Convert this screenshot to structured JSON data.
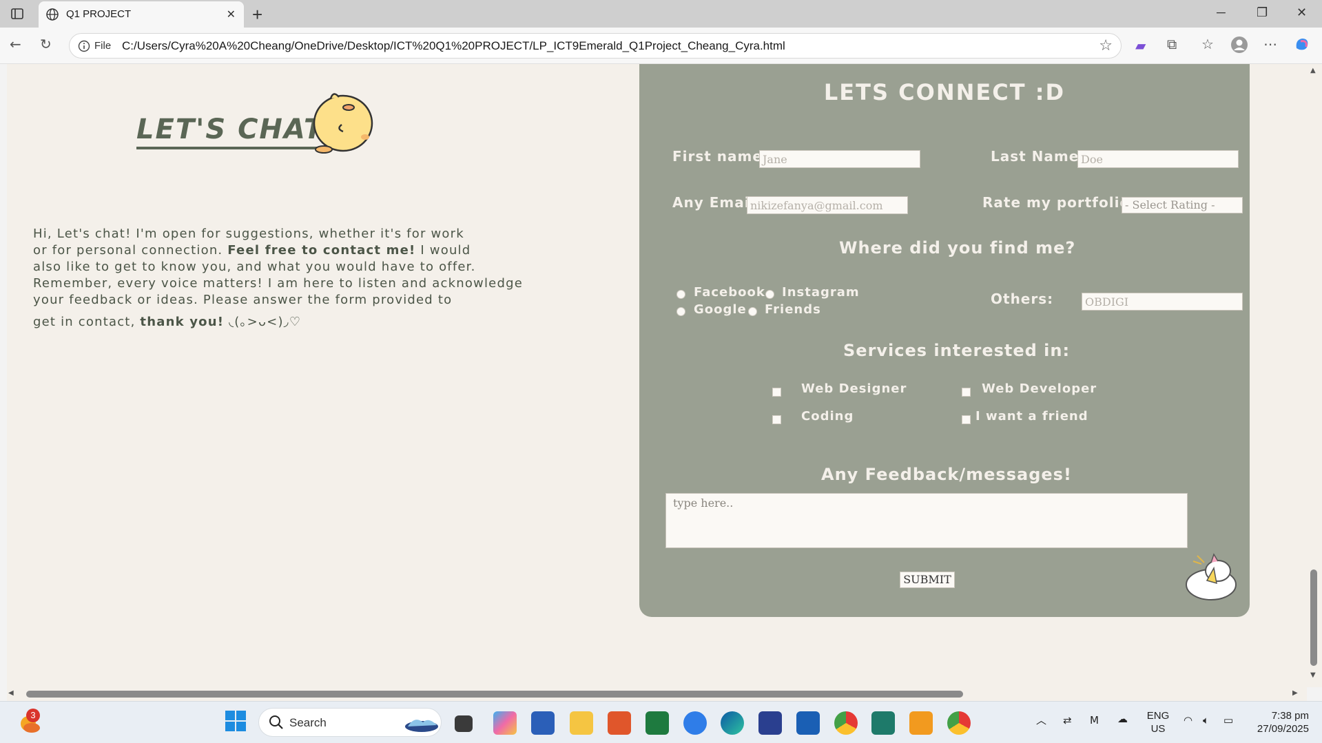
{
  "browser": {
    "tab_title": "Q1 PROJECT",
    "address_prefix": "File",
    "url": "C:/Users/Cyra%20A%20Cheang/OneDrive/Desktop/ICT%20Q1%20PROJECT/LP_ICT9Emerald_Q1Project_Cheang_Cyra.html"
  },
  "left": {
    "title": "LET'S CHAT",
    "intro_line1": "Hi, Let's chat! I'm open for suggestions, whether it's for work",
    "intro_line2a": "or for personal connection. ",
    "intro_line2b": "Feel free to contact me!",
    "intro_line2c": " I would",
    "intro_line3": "also like to get to know you, and what you would have to offer.",
    "intro_line4": "Remember, every voice matters! I am here to listen and acknowledge",
    "intro_line5": "your feedback or ideas. Please answer the form provided to",
    "intro_line6a": "get in contact, ",
    "intro_line6b": "thank you!",
    "intro_line6c": " ◟(｡>ᴗ<)◞♡"
  },
  "form": {
    "title": "LETS CONNECT :D",
    "first_name_label": "First name:",
    "first_name_placeholder": "Jane",
    "last_name_label": "Last Name:",
    "last_name_placeholder": "Doe",
    "email_label": "Any Email:",
    "email_placeholder": "nikizefanya@gmail.com",
    "rate_label": "Rate my portfolio!:",
    "rate_selected": "- Select Rating -",
    "find_title": "Where did you find me?",
    "find_options": [
      "Facebook",
      "Instagram",
      "Google",
      "Friends"
    ],
    "others_label": "Others:",
    "others_placeholder": "OBDIGI",
    "services_title": "Services interested in:",
    "services": [
      "Web Designer",
      "Web Developer",
      "Coding",
      "I want a friend"
    ],
    "feedback_title": "Any Feedback/messages!",
    "feedback_placeholder": "type here..",
    "submit_label": "SUBMIT"
  },
  "taskbar": {
    "search_label": "Search",
    "notification_count": "3",
    "lang_line1": "ENG",
    "lang_line2": "US",
    "time": "7:38 pm",
    "date": "27/09/2025"
  },
  "colors": {
    "page_bg": "#f4f0ea",
    "card_bg": "#9aa092",
    "heading_green": "#5a6655",
    "text_on_card": "#f4f0ea"
  }
}
